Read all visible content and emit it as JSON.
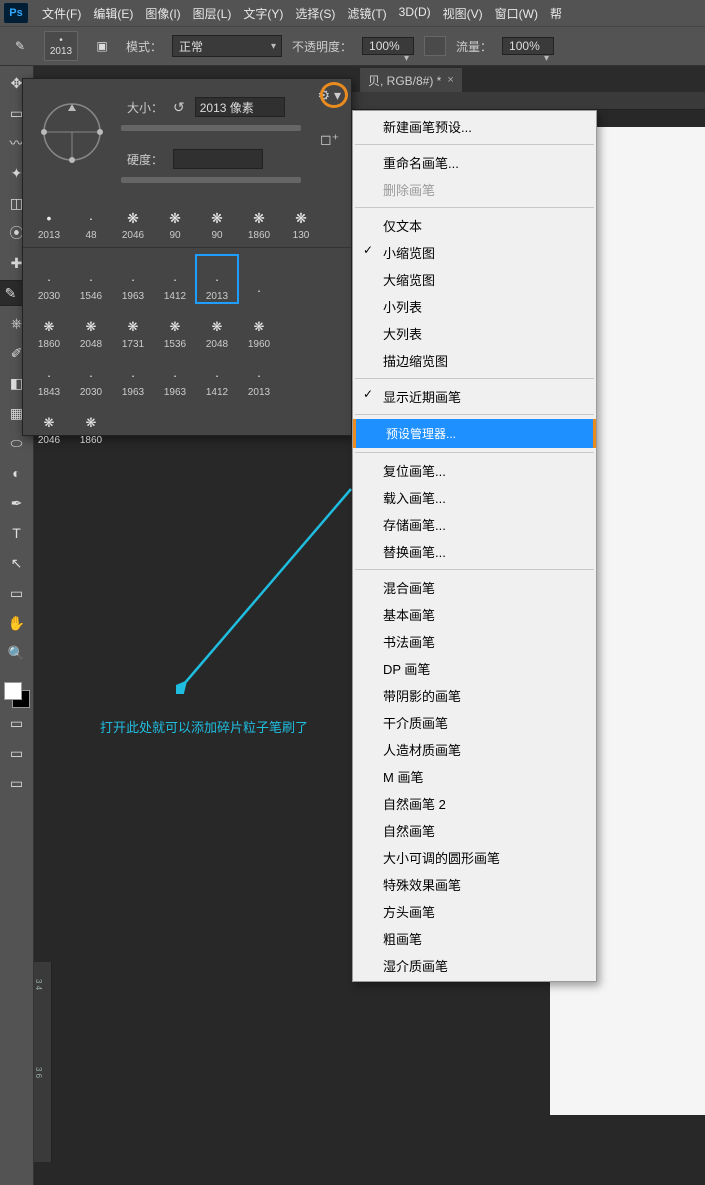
{
  "app": {
    "name": "Ps"
  },
  "menubar": {
    "items": [
      "文件(F)",
      "编辑(E)",
      "图像(I)",
      "图层(L)",
      "文字(Y)",
      "选择(S)",
      "滤镜(T)",
      "3D(D)",
      "视图(V)",
      "窗口(W)",
      "帮"
    ]
  },
  "optionsbar": {
    "brush_size": "2013",
    "mode_label": "模式：",
    "mode_value": "正常",
    "opacity_label": "不透明度：",
    "opacity_value": "100%",
    "flow_label": "流量：",
    "flow_value": "100%"
  },
  "doc_tab": {
    "title": "贝, RGB/8#) *"
  },
  "brush_panel": {
    "size_label": "大小：",
    "size_value": "2013 像素",
    "hardness_label": "硬度：",
    "recent": [
      {
        "n": "2013",
        "g": "•"
      },
      {
        "n": "48",
        "g": "·"
      },
      {
        "n": "2046",
        "g": "❋"
      },
      {
        "n": "90",
        "g": "❋"
      },
      {
        "n": "90",
        "g": "❋"
      },
      {
        "n": "1860",
        "g": "❋"
      },
      {
        "n": "130",
        "g": "❋"
      }
    ],
    "grid": [
      {
        "n": "2030",
        "g": "·"
      },
      {
        "n": "1546",
        "g": "·"
      },
      {
        "n": "1963",
        "g": "·"
      },
      {
        "n": "1412",
        "g": "·"
      },
      {
        "n": "2013",
        "g": "·",
        "sel": true
      },
      {
        "n": "",
        "g": "·"
      },
      {
        "n": "1860",
        "g": "❋"
      },
      {
        "n": "2048",
        "g": "❋"
      },
      {
        "n": "1731",
        "g": "❋"
      },
      {
        "n": "1536",
        "g": "❋"
      },
      {
        "n": "2048",
        "g": "❋"
      },
      {
        "n": "1960",
        "g": "❋"
      },
      {
        "n": "1843",
        "g": "·"
      },
      {
        "n": "2030",
        "g": "·"
      },
      {
        "n": "1963",
        "g": "·"
      },
      {
        "n": "1963",
        "g": "·"
      },
      {
        "n": "1412",
        "g": "·"
      },
      {
        "n": "2013",
        "g": "·"
      },
      {
        "n": "2046",
        "g": "❋"
      },
      {
        "n": "1860",
        "g": "❋"
      }
    ]
  },
  "context_menu": {
    "groups": [
      {
        "items": [
          {
            "t": "新建画笔预设..."
          }
        ]
      },
      {
        "items": [
          {
            "t": "重命名画笔..."
          },
          {
            "t": "删除画笔",
            "disabled": true
          }
        ]
      },
      {
        "items": [
          {
            "t": "仅文本"
          },
          {
            "t": "小缩览图",
            "check": true
          },
          {
            "t": "大缩览图"
          },
          {
            "t": "小列表"
          },
          {
            "t": "大列表"
          },
          {
            "t": "描边缩览图"
          }
        ]
      },
      {
        "items": [
          {
            "t": "显示近期画笔",
            "check": true
          }
        ]
      },
      {
        "items": [
          {
            "t": "预设管理器...",
            "hl": true
          }
        ]
      },
      {
        "items": [
          {
            "t": "复位画笔..."
          },
          {
            "t": "载入画笔..."
          },
          {
            "t": "存储画笔..."
          },
          {
            "t": "替换画笔..."
          }
        ]
      },
      {
        "items": [
          {
            "t": "混合画笔"
          },
          {
            "t": "基本画笔"
          },
          {
            "t": "书法画笔"
          },
          {
            "t": "DP 画笔"
          },
          {
            "t": "带阴影的画笔"
          },
          {
            "t": "干介质画笔"
          },
          {
            "t": "人造材质画笔"
          },
          {
            "t": "M 画笔"
          },
          {
            "t": "自然画笔 2"
          },
          {
            "t": "自然画笔"
          },
          {
            "t": "大小可调的圆形画笔"
          },
          {
            "t": "特殊效果画笔"
          },
          {
            "t": "方头画笔"
          },
          {
            "t": "粗画笔"
          },
          {
            "t": "湿介质画笔"
          }
        ]
      }
    ]
  },
  "annotation": {
    "text": "打开此处就可以添加碎片粒子笔刷了"
  },
  "ruler": {
    "ticks": [
      "3\n4",
      "",
      "3\n6"
    ]
  },
  "toolbar": {
    "tools": [
      {
        "n": "move",
        "g": "✥"
      },
      {
        "n": "marquee",
        "g": "▭"
      },
      {
        "n": "lasso",
        "g": "〰"
      },
      {
        "n": "wand",
        "g": "✦"
      },
      {
        "n": "crop",
        "g": "◫"
      },
      {
        "n": "eyedropper",
        "g": "⦿"
      },
      {
        "n": "heal",
        "g": "✚"
      },
      {
        "n": "brush",
        "g": "✎",
        "sel": true
      },
      {
        "n": "stamp",
        "g": "⎈"
      },
      {
        "n": "history",
        "g": "✐"
      },
      {
        "n": "eraser",
        "g": "◧"
      },
      {
        "n": "gradient",
        "g": "▦"
      },
      {
        "n": "blur",
        "g": "⬭"
      },
      {
        "n": "dodge",
        "g": "◐"
      },
      {
        "n": "pen",
        "g": "✒"
      },
      {
        "n": "type",
        "g": "T"
      },
      {
        "n": "path",
        "g": "↖"
      },
      {
        "n": "shape",
        "g": "▭"
      },
      {
        "n": "hand",
        "g": "✋"
      },
      {
        "n": "zoom",
        "g": "🔍"
      }
    ]
  }
}
